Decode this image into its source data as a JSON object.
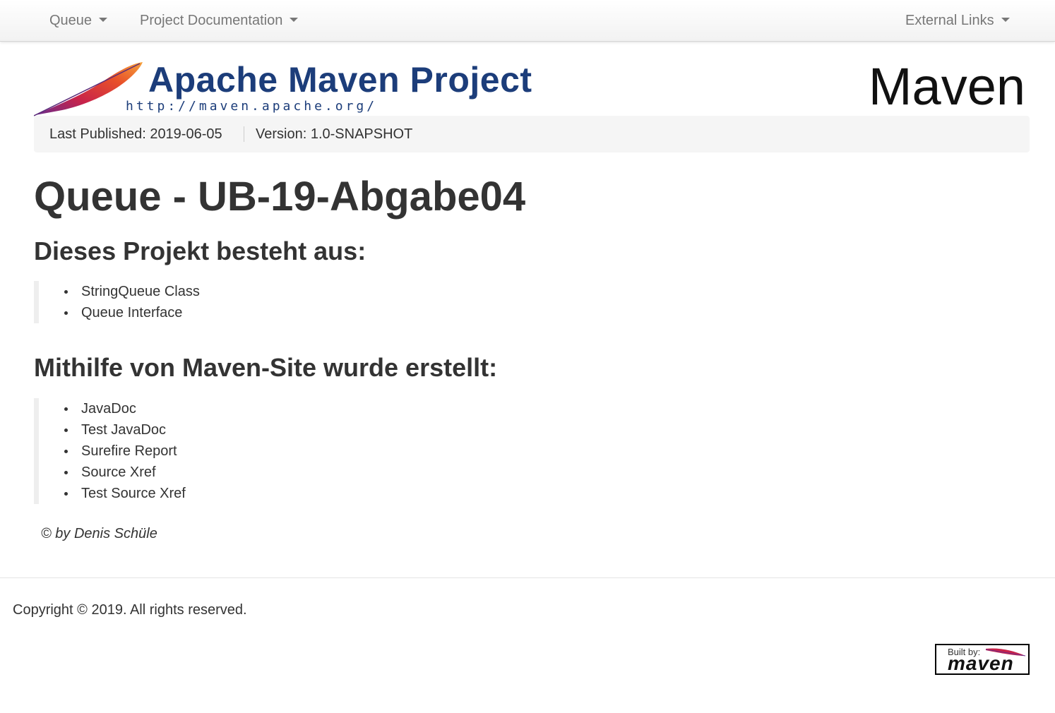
{
  "navbar": {
    "queue_label": "Queue",
    "project_docs_label": "Project Documentation",
    "external_links_label": "External Links"
  },
  "banner": {
    "title": "Apache Maven Project",
    "url": "http://maven.apache.org/",
    "right_logo_text": "Maven"
  },
  "breadcrumb": {
    "last_published": "Last Published: 2019-06-05",
    "version": "Version: 1.0-SNAPSHOT"
  },
  "main": {
    "title": "Queue - UB-19-Abgabe04",
    "section1": {
      "heading": "Dieses Projekt besteht aus:",
      "items": [
        "StringQueue Class",
        "Queue Interface"
      ]
    },
    "section2": {
      "heading": "Mithilfe von Maven-Site wurde erstellt:",
      "items": [
        "JavaDoc",
        "Test JavaDoc",
        "Surefire Report",
        "Source Xref",
        "Test Source Xref"
      ]
    },
    "author": "© by Denis Schüle"
  },
  "footer": {
    "copyright": "Copyright © 2019. All rights reserved.",
    "built_by_small": "Built by:",
    "built_by_big": "maven"
  },
  "colors": {
    "link_text": "#777777",
    "banner_blue": "#1c3d7a",
    "breadcrumb_bg": "#f5f5f5"
  },
  "icons": {
    "feather": "apache-feather-icon",
    "caret": "caret-down-icon"
  }
}
